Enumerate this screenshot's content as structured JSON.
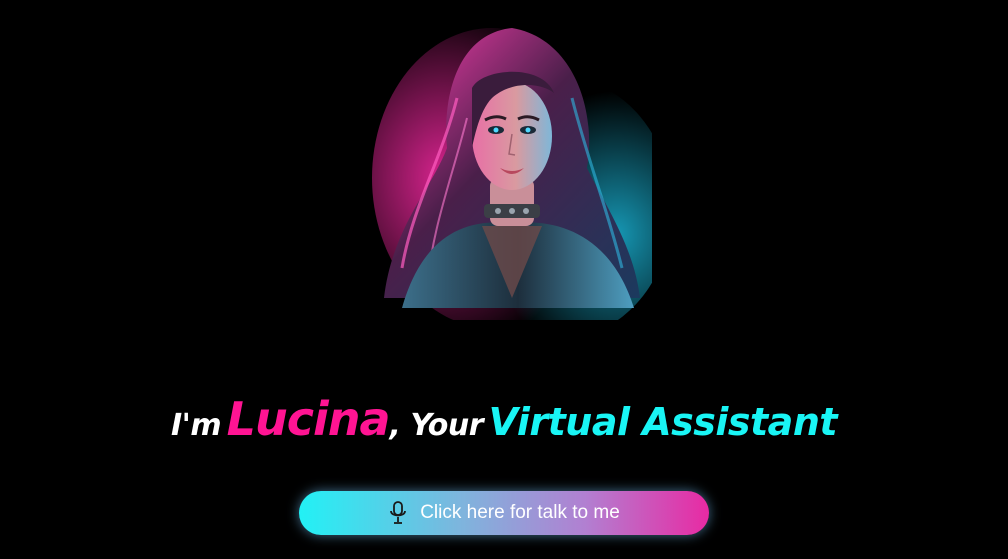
{
  "hero": {
    "image_alt": "Lucina avatar portrait",
    "avatar_icon": "avatar-portrait"
  },
  "headline": {
    "part1": "I'm",
    "name": "Lucina",
    "part2": ", Your",
    "accent": "Virtual Assistant"
  },
  "talk_button": {
    "label": "Click here for talk to me",
    "icon": "microphone-icon"
  },
  "colors": {
    "background": "#000000",
    "name": "#ff1493",
    "accent": "#19f5f5",
    "button_start": "#22f1f5",
    "button_end": "#e82aa3"
  }
}
